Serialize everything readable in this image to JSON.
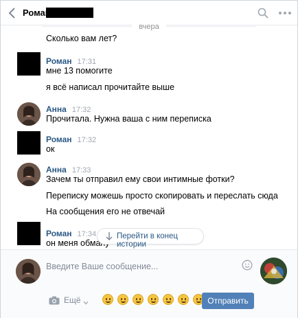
{
  "header": {
    "contact_name": "Роман"
  },
  "date_separator": "вчера",
  "messages": [
    {
      "author": "",
      "time": "",
      "lines": [
        "Сколько вам лет?"
      ]
    },
    {
      "author": "Роман",
      "time": "17:31",
      "lines": [
        "мне 13 помогите",
        "я всё написал прочитайте выше"
      ]
    },
    {
      "author": "Анна",
      "time": "17:32",
      "lines": [
        "Прочитала. Нужна ваша с ним переписка"
      ]
    },
    {
      "author": "Роман",
      "time": "17:32",
      "lines": [
        "ок"
      ]
    },
    {
      "author": "Анна",
      "time": "17:33",
      "lines": [
        "Зачем ты отправил ему свои интимные фотки?",
        "Переписку можешь просто скопировать и переслать сюда",
        "На сообщения его не отвечай"
      ]
    },
    {
      "author": "Роман",
      "time": "17:34",
      "lines": [
        "он меня обману"
      ]
    }
  ],
  "jump_button": "Перейти в конец истории",
  "composer": {
    "placeholder": "Введите Ваше сообщение...",
    "attach_more": "Ещё",
    "send_label": "Отправить"
  },
  "colors": {
    "link": "#2a5885",
    "send_button": "#5181b8",
    "muted": "#828a99"
  },
  "icons": [
    "back-icon",
    "search-icon",
    "more-icon",
    "arrow-down-icon",
    "emoji-icon",
    "camera-icon",
    "chevron-down-icon"
  ]
}
